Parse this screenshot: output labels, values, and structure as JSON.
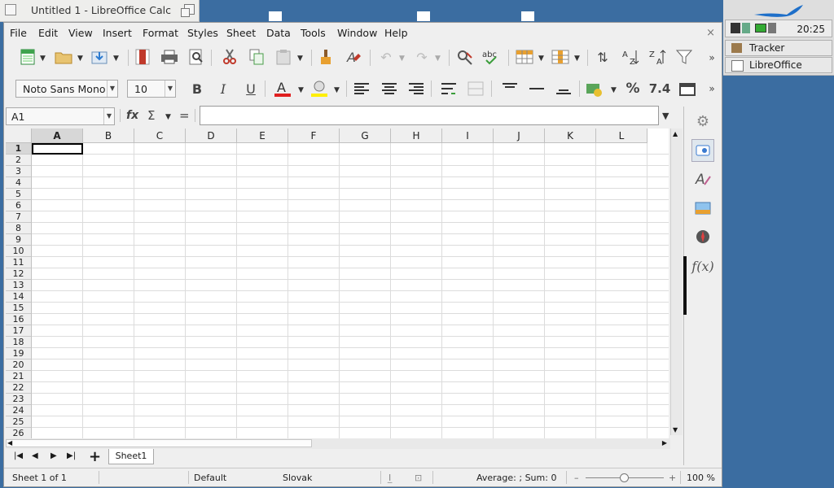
{
  "window": {
    "title": "Untitled 1 - LibreOffice Calc"
  },
  "menu": {
    "items": [
      "File",
      "Edit",
      "View",
      "Insert",
      "Format",
      "Styles",
      "Sheet",
      "Data",
      "Tools",
      "Window",
      "Help"
    ],
    "close_glyph": "×"
  },
  "toolbar_formatting": {
    "font_name": "Noto Sans Mono",
    "font_size": "10",
    "number_format_glyph": "%",
    "number_glyph": "7.4"
  },
  "formula_bar": {
    "cell_reference": "A1",
    "function_glyph": "fx",
    "sum_glyph": "Σ",
    "equals_glyph": "=",
    "input_value": ""
  },
  "grid": {
    "columns": [
      "A",
      "B",
      "C",
      "D",
      "E",
      "F",
      "G",
      "H",
      "I",
      "J",
      "K",
      "L"
    ],
    "rows": [
      "1",
      "2",
      "3",
      "4",
      "5",
      "6",
      "7",
      "8",
      "9",
      "10",
      "11",
      "12",
      "13",
      "14",
      "15",
      "16",
      "17",
      "18",
      "19",
      "20",
      "21",
      "22",
      "23",
      "24",
      "25",
      "26"
    ],
    "active_cell": "A1"
  },
  "sheets": {
    "tabs": [
      "Sheet1"
    ],
    "add_glyph": "+"
  },
  "statusbar": {
    "sheet_position": "Sheet 1 of 1",
    "page_style": "Default",
    "language": "Slovak",
    "selection_summary": "Average: ; Sum: 0",
    "zoom": "100 %",
    "zoom_minus": "–",
    "zoom_plus": "+"
  },
  "sidebar": {
    "function_glyph": "f(x)"
  },
  "tray": {
    "clock": "20:25",
    "tasks": [
      "Tracker",
      "LibreOffice"
    ]
  },
  "colors": {
    "desktop": "#3b6da1",
    "font_color_underline": "#e02020",
    "highlight_underline": "#ffef00"
  }
}
